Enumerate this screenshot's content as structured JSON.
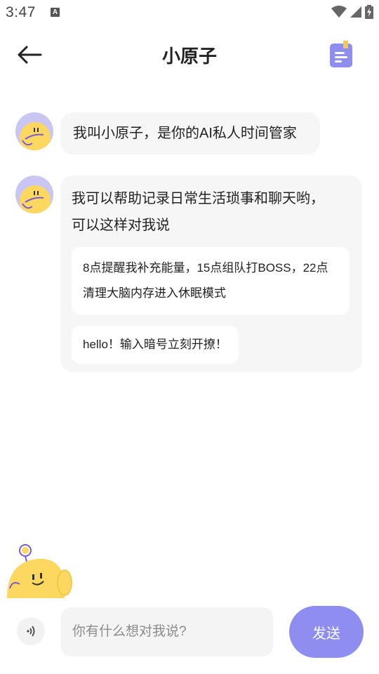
{
  "status_bar": {
    "time": "3:47",
    "notification_icon": "A"
  },
  "header": {
    "title": "小原子",
    "back_icon": "arrow-left-icon",
    "notes_icon": "notebook-icon"
  },
  "messages": [
    {
      "text": "我叫小原子，是你的AI私人时间管家"
    },
    {
      "intro_line1": "我可以帮助记录日常生活琐事和聊天哟，",
      "intro_line2": "可以这样对我说",
      "suggestions": [
        {
          "line1": "8点提醒我补充能量，15点组队打BOSS，22点",
          "line2": "清理大脑内存进入休眠模式"
        },
        {
          "line1": "hello！输入暗号立刻开撩！"
        }
      ]
    }
  ],
  "input": {
    "placeholder": "你有什么想对我说?",
    "value": "",
    "send_label": "发送",
    "voice_icon": "voice-icon"
  },
  "colors": {
    "accent": "#8f8ef0",
    "bubble": "#f6f6f6",
    "avatar_bg": "#c9c6f4",
    "mascot": "#fcd860"
  }
}
